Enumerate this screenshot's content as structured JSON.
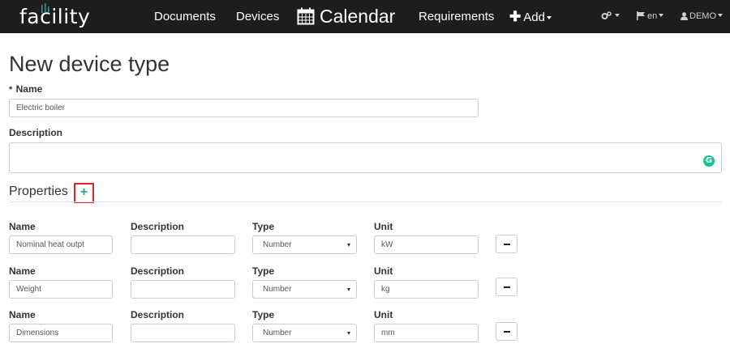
{
  "nav": {
    "brand": "facility",
    "links": [
      "Documents",
      "Devices",
      "Calendar",
      "Requirements"
    ],
    "add_label": "Add",
    "language": "en",
    "user": "DEMO",
    "icons": [
      "cogs-icon",
      "calendar-icon",
      "plus-icon",
      "flag-icon",
      "user-icon"
    ]
  },
  "page": {
    "title": "New device type",
    "name_required_mark": "*",
    "name_label": "Name",
    "name_value": "Electric boiler",
    "description_label": "Description",
    "description_value": "",
    "properties_title": "Properties",
    "add_property_symbol": "+"
  },
  "property_headers": {
    "name": "Name",
    "description": "Description",
    "type": "Type",
    "unit": "Unit"
  },
  "properties": [
    {
      "name": "Nominal heat outpt",
      "description": "",
      "type": "Number",
      "unit": "kW"
    },
    {
      "name": "Weight",
      "description": "",
      "type": "Number",
      "unit": "kg"
    },
    {
      "name": "Dimensions",
      "description": "",
      "type": "Number",
      "unit": "mm"
    }
  ],
  "colors": {
    "navbar": "#1d1d1d",
    "highlight_box": "#e0262a",
    "accent_plus": "#26a69a",
    "grammarly": "#15c39a"
  }
}
